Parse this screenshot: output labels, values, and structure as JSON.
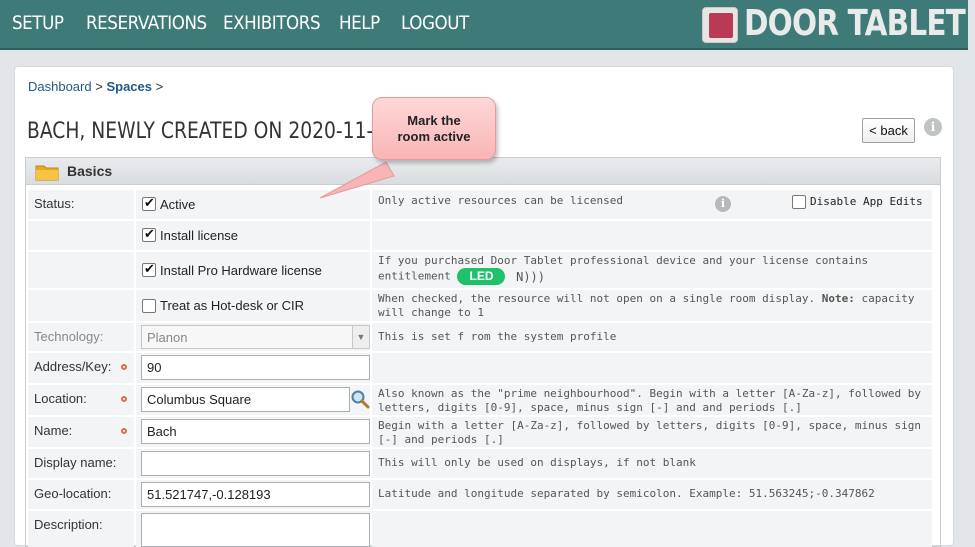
{
  "nav": {
    "items": [
      "SETUP",
      "RESERVATIONS",
      "EXHIBITORS",
      "HELP",
      "LOGOUT"
    ],
    "brand": "DOOR TABLET UI"
  },
  "breadcrumb": {
    "dashboard": "Dashboard",
    "sep1": ">",
    "spaces": "Spaces",
    "sep2": ">"
  },
  "page": {
    "title": "BACH, NEWLY CREATED ON 2020-11-24",
    "back_label": "< back",
    "help_glyph": "i"
  },
  "callout": {
    "text_line1": "Mark the",
    "text_line2": "room active"
  },
  "section": {
    "title": "Basics",
    "rows": {
      "status": {
        "label": "Status:",
        "active_label": "Active",
        "active_checked": true,
        "help": "Only active resources can be licensed",
        "disable_edits_label": "Disable App Edits",
        "disable_edits_checked": false
      },
      "install_license": {
        "label": "Install license",
        "checked": true
      },
      "install_pro": {
        "label": "Install Pro Hardware license",
        "checked": true,
        "help_line1": "If you purchased Door Tablet professional device and your license contains",
        "help_line2": "entitlement",
        "badge": "LED"
      },
      "hotdesk": {
        "label": "Treat as Hot-desk or CIR",
        "checked": false,
        "help_line1": "When checked, the resource will not open on a single room display.",
        "note_label": "Note:",
        "help_line1_end": "capacity",
        "help_line2": "will change to 1"
      },
      "technology": {
        "label": "Technology:",
        "value": "Planon",
        "help": "This is set f rom the system profile"
      },
      "address": {
        "label": "Address/Key:",
        "value": "90"
      },
      "location": {
        "label": "Location:",
        "value": "Columbus Square",
        "help_line1": "Also known as the \"prime neighbourhood\". Begin with a letter [A-Za-z], followed by",
        "help_line2": "letters, digits [0-9], space, minus sign [-] and and periods [.]"
      },
      "name": {
        "label": "Name:",
        "value": "Bach",
        "help_line1": "Begin with a letter [A-Za-z], followed by letters, digits [0-9], space, minus sign",
        "help_line2": "[-] and periods [.]"
      },
      "display_name": {
        "label": "Display name:",
        "value": "",
        "help": "This will only be used on displays, if not blank"
      },
      "geo": {
        "label": "Geo-location:",
        "value": "51.521747,-0.128193",
        "help": "Latitude and longitude separated by semicolon.  Example: 51.563245;-0.347862"
      },
      "description": {
        "label": "Description:",
        "value": ""
      }
    }
  },
  "colors": {
    "topbar": "#3d7a78",
    "accent_link": "#1e5a8a",
    "required": "#e0703a",
    "badge": "#1fc16b",
    "callout": "#f8b5b5"
  }
}
